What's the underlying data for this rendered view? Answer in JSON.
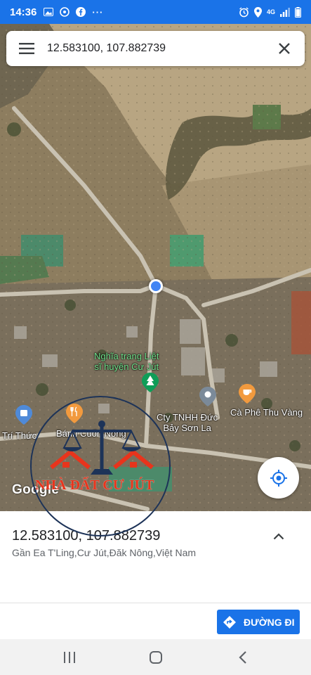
{
  "status_bar": {
    "time": "14:36",
    "left_icons": [
      "image-icon",
      "maps-icon",
      "facebook-icon",
      "more-icon"
    ],
    "right_icons": [
      "alarm-icon",
      "location-icon",
      "4g-icon",
      "wifi-icon",
      "signal-icon",
      "battery-icon"
    ],
    "network_label": "4G"
  },
  "search": {
    "query": "12.583100, 107.882739"
  },
  "map": {
    "labels": {
      "cemetery": "Nghĩa trang Liệt\nsĩ huyện Cư Jút",
      "company": "Cty TNHH Đức\nBảy Sơn La",
      "cafe": "Cà Phê Thu Vàng",
      "school": "Trí Thức",
      "bakery": "Bánh Cuốn Nóng"
    },
    "google_logo": "Google"
  },
  "watermark": {
    "text": "NHÀ ĐẤT CƯ JÚT"
  },
  "place": {
    "coords": "12.583100, 107.882739",
    "address": "Gần Ea T'Ling,Cư Jút,Đăk Nông,Việt Nam"
  },
  "actions": {
    "directions_label": "ĐƯỜNG ĐI"
  },
  "colors": {
    "accent": "#1a73e8",
    "watermark_red": "#e8341c",
    "watermark_navy": "#1d3358",
    "location_dot": "#4285f4"
  }
}
